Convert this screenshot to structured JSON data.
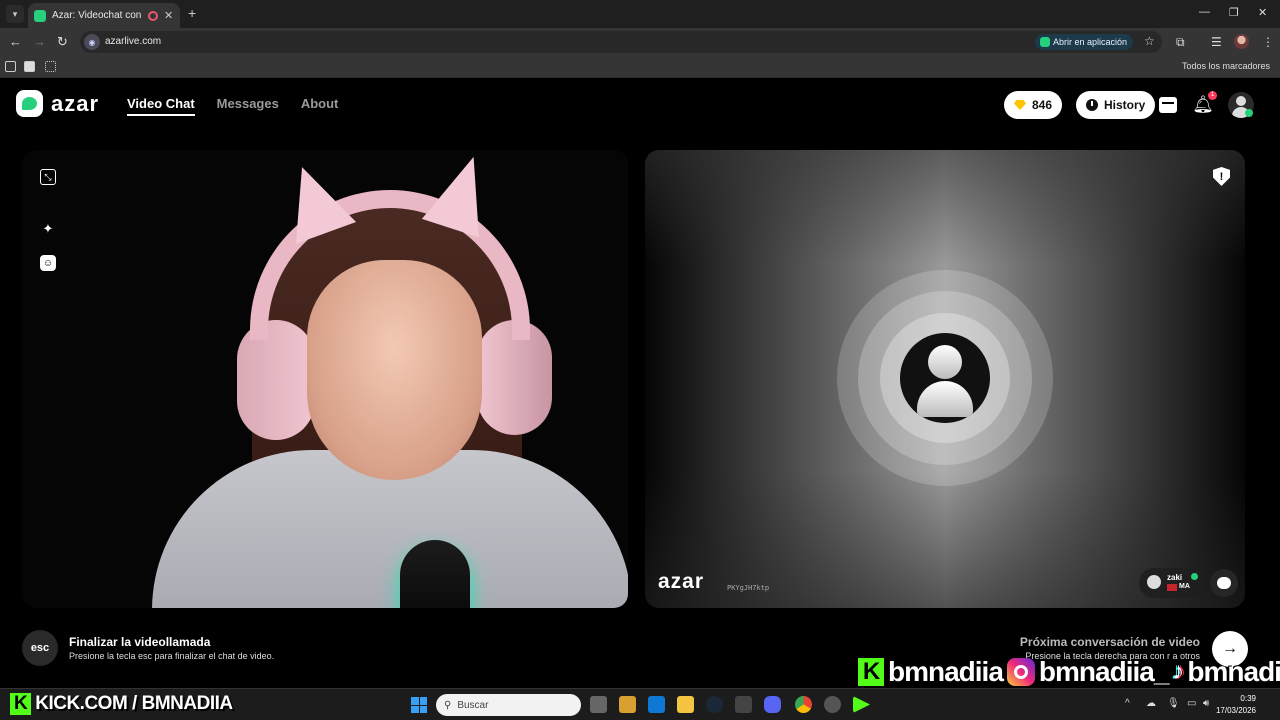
{
  "browser": {
    "tab_title": "Azar: Videochat con gente",
    "url": "azarlive.com",
    "open_in_app": "Abrir en aplicación",
    "all_bookmarks": "Todos los marcadores"
  },
  "header": {
    "logo": "azar",
    "nav": [
      "Video Chat",
      "Messages",
      "About"
    ],
    "gems": "846",
    "history": "History",
    "notification_count": "1"
  },
  "partner": {
    "logo": "azar",
    "code": "PKYgJH7ktp",
    "name": "zaki",
    "country": "MA"
  },
  "controls": {
    "esc_key": "esc",
    "end_title": "Finalizar la videollamada",
    "end_hint": "Presione la tecla esc para finalizar el chat de video.",
    "next_title": "Próxima conversación de video",
    "next_hint": "Presione la tecla derecha para con   r a otros"
  },
  "overlay": {
    "social_kick": "bmnadiia",
    "social_instagram": "bmnadiia_",
    "social_tiktok": "bmnadiia",
    "kick_url_k": "K",
    "kick_url": "KICK.COM / BMNADIIA"
  },
  "taskbar": {
    "search_placeholder": "Buscar",
    "time": "0:39",
    "date": "17/03/2026"
  }
}
